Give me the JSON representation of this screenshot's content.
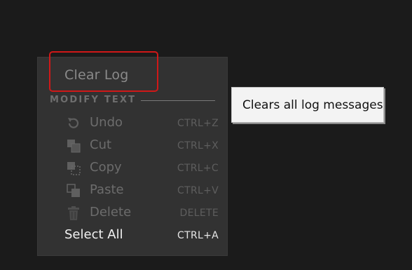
{
  "menu": {
    "clear_log_label": "Clear Log",
    "section_header": "MODIFY TEXT",
    "items": [
      {
        "label": "Undo",
        "shortcut": "CTRL+Z",
        "icon": "undo-icon",
        "enabled": false
      },
      {
        "label": "Cut",
        "shortcut": "CTRL+X",
        "icon": "cut-icon",
        "enabled": false
      },
      {
        "label": "Copy",
        "shortcut": "CTRL+C",
        "icon": "copy-icon",
        "enabled": false
      },
      {
        "label": "Paste",
        "shortcut": "CTRL+V",
        "icon": "paste-icon",
        "enabled": false
      },
      {
        "label": "Delete",
        "shortcut": "DELETE",
        "icon": "trash-icon",
        "enabled": false
      },
      {
        "label": "Select All",
        "shortcut": "CTRL+A",
        "icon": null,
        "enabled": true
      }
    ]
  },
  "tooltip": {
    "text": "Clears all log messages"
  },
  "colors": {
    "background": "#1b1b1b",
    "menu_background": "#323232",
    "highlight": "#d01818",
    "disabled_text": "#6c6c6c",
    "enabled_text": "#f2f2f2",
    "tooltip_background": "#f3f3f3"
  }
}
